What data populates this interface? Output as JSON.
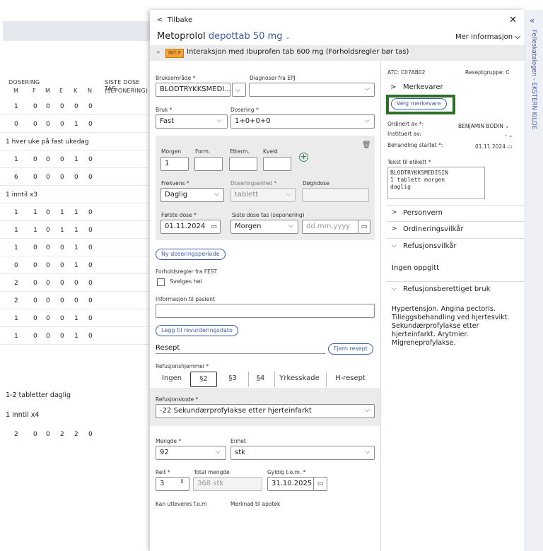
{
  "background_table": {
    "header_dosering": "DOSERING",
    "header_siste": "SISTE DOSE TAS",
    "header_seponering": "(SEPONERING)",
    "columns": [
      "M",
      "F",
      "M",
      "E",
      "K",
      "N"
    ],
    "rows": [
      {
        "values": [
          "1",
          "0",
          "0",
          "0",
          "0",
          "0"
        ]
      },
      {
        "values": [
          "0",
          "0",
          "0",
          "0",
          "1",
          "0"
        ]
      },
      {
        "note": "1 hver uke på fast ukedag"
      },
      {
        "values": [
          "1",
          "0",
          "0",
          "0",
          "1",
          "0"
        ]
      },
      {
        "values": [
          "6",
          "0",
          "0",
          "0",
          "0",
          "0"
        ]
      },
      {
        "note": "1 inntil x3"
      },
      {
        "values": [
          "1",
          "1",
          "0",
          "1",
          "1",
          "0"
        ]
      },
      {
        "values": [
          "1",
          "1",
          "0",
          "1",
          "1",
          "0"
        ]
      },
      {
        "values": [
          "1",
          "0",
          "0",
          "0",
          "1",
          "0"
        ]
      },
      {
        "values": [
          "0",
          "0",
          "0",
          "0",
          "1",
          "0"
        ]
      },
      {
        "values": [
          "2",
          "0",
          "0",
          "0",
          "0",
          "0"
        ]
      },
      {
        "values": [
          "2",
          "0",
          "0",
          "0",
          "0",
          "0"
        ]
      },
      {
        "values": [
          "1",
          "0",
          "0",
          "0",
          "1",
          "0"
        ]
      },
      {
        "values": [
          "1",
          "0",
          "0",
          "0",
          "1",
          "0"
        ]
      }
    ],
    "note_tabletter": "1-2 tabletter daglig",
    "note_inntil4": "1 inntil x4",
    "last_row": [
      "2",
      "0",
      "0",
      "2",
      "2",
      "0"
    ]
  },
  "modal": {
    "back_label": "Tilbake",
    "close_glyph": "✕",
    "drug_name": "Metoprolol",
    "drug_form": "depottab 50 mg",
    "more_info": "Mer informasjon",
    "interaction_badge": "INT F",
    "interaction_text": "Interaksjon med Ibuprofen tab 600 mg (Forholdsregler bør tas)",
    "form": {
      "bruksomrade_label": "Bruksområde *",
      "bruksomrade_value": "BLODTRYKKSMEDI...",
      "diagnoser_label": "Diagnoser fra EPJ",
      "diagnoser_value": "",
      "bruk_label": "Bruk *",
      "bruk_value": "Fast",
      "dosering_label": "Dosering *",
      "dosering_value": "1+0+0+0",
      "morgen_label": "Morgen",
      "form_label": "Form.",
      "etterm_label": "Etterm.",
      "kveld_label": "Kveld",
      "morgen_value": "1",
      "frekvens_label": "Frekvens *",
      "frekvens_value": "Daglig",
      "doseringsenhet_label": "Doseringsenhet *",
      "doseringsenhet_value": "tablett",
      "dogndose_label": "Døgndose",
      "forste_dose_label": "Første dose *",
      "forste_dose_value": "01.11.2024",
      "siste_dose_label": "Siste dose tas (seponering)",
      "siste_dose_value": "Morgen",
      "siste_dose_date_placeholder": "dd.mm.yyyy",
      "ny_dosering_button": "Ny doseringsperiode",
      "forholdsregler_label": "Forholdsregler fra FEST",
      "svelges_hel_label": "Svelges hel",
      "info_pasient_label": "Informasjon til pasient",
      "revurdering_button": "Legg til revurderingsdato",
      "resept_label": "Resept",
      "fjern_resept_button": "Fjern resept",
      "refusjonshjemmel_label": "Refusjonshjemmel *",
      "refusjon_options": [
        "Ingen",
        "§2",
        "§3",
        "§4",
        "Yrkesskade",
        "H-resept"
      ],
      "refusjon_selected": "§2",
      "refusjonskode_label": "Refusjonskode *",
      "refusjonskode_value": "-22 Sekundærprofylakse etter hjerteinfarkt",
      "mengde_label": "Mengde *",
      "mengde_value": "92",
      "enhet_label": "Enhet",
      "enhet_value": "stk",
      "reit_label": "Reit *",
      "reit_value": "3",
      "total_mengde_label": "Total mengde",
      "total_mengde_value": "368 stk",
      "gyldig_label": "Gyldig t.o.m. *",
      "gyldig_value": "31.10.2025",
      "kan_utleveres_label": "Kan utleveres f.o.m",
      "merknad_label": "Merknad til apotek"
    },
    "right": {
      "atc": "ATC: C07AB02",
      "reseptgruppe": "Reseptgruppe: C",
      "merkevarer": "Merkevarer",
      "velg_merkevare": "Velg merkevare",
      "ordinert_av_label": "Ordinert av *:",
      "ordinert_av_value": "BENJAMIN BODIN",
      "instituert_av_label": "Instituert av:",
      "instituert_av_value": "-",
      "behandling_label": "Behandling startet *:",
      "behandling_value": "01.11.2024",
      "tekst_etikett_label": "Tekst til etikett *",
      "tekst_etikett_value": "BLODTRYKKSMEDISIN\n1 tablett morgen\ndaglig",
      "personvern": "Personvern",
      "ordineringsvilkar": "Ordineringsvilkår",
      "refusjonsvilkar": "Refusjonsvilkår",
      "ingen_oppgitt": "Ingen oppgitt",
      "refusjonsberettiget": "Refusjonsberettiget bruk",
      "refusjonsberettiget_text": "Hypertensjon. Angina pectoris. Tilleggsbehandling ved hjertesvikt. Sekundærprofylakse etter hjerteinfarkt. Arytmier. Migreneprofylakse."
    }
  },
  "side_panel": {
    "label": "Felleskatalogen - EKSTERN KILDE",
    "collapse_glyph": "«"
  },
  "colors": {
    "accent_blue": "#3b5ba9",
    "highlight_green": "#2e6f2a",
    "badge_orange": "#f2a33a",
    "panel_gray": "#ebebeb"
  }
}
